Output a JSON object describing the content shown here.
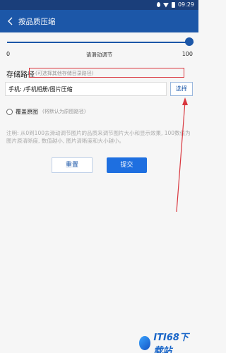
{
  "status_bar": {
    "time": "09:29"
  },
  "toolbar": {
    "title": "按品质压缩"
  },
  "slider": {
    "min": "0",
    "max": "100",
    "hint": "请滑动调节",
    "value": 100
  },
  "path": {
    "label": "存储路径",
    "hint": "(可选择其他存储目录路径)",
    "value": "手机: /手机相册/图片压缩",
    "select_label": "选择"
  },
  "overwrite": {
    "label": "覆盖原图",
    "hint": "(将默认为原图路径)",
    "checked": false
  },
  "note": "注明: 从0到100去滑动调节图片的品质来调节图片大小和显示效果, 100数值为图片原清晰度, 数值越小, 图片清晰度和大小越小。",
  "buttons": {
    "reset": "重置",
    "submit": "提交"
  },
  "watermark": {
    "text": "ITI68下载站"
  },
  "colors": {
    "toolbar": "#1c57a8",
    "primary": "#1e6fe0",
    "annotation": "#d9363e"
  }
}
